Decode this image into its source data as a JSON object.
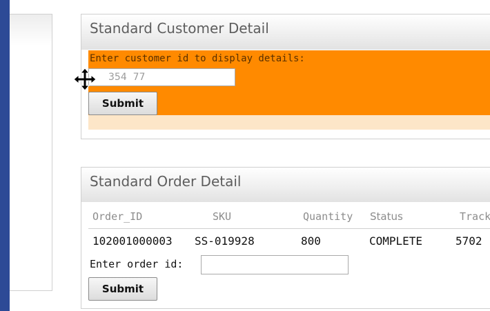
{
  "customer_detail": {
    "title": "Standard Customer Detail",
    "prompt": "Enter customer id to display details:",
    "input_value": "354  77",
    "submit_label": "Submit"
  },
  "order_detail": {
    "title": "Standard Order Detail",
    "columns": [
      "Order_ID",
      "SKU",
      "Quantity",
      "Status",
      "Track"
    ],
    "rows": [
      [
        "102001000003",
        "SS-019928",
        "800",
        "COMPLETE",
        "5702"
      ]
    ],
    "order_id_label": "Enter order id:",
    "order_id_value": "",
    "submit_label": "Submit"
  },
  "colors": {
    "sidebar": "#2d4a96",
    "orange_box": "#ff8a00",
    "peach_strip": "#fde6c8"
  },
  "cursor": {
    "icon": "move-cursor-icon"
  }
}
